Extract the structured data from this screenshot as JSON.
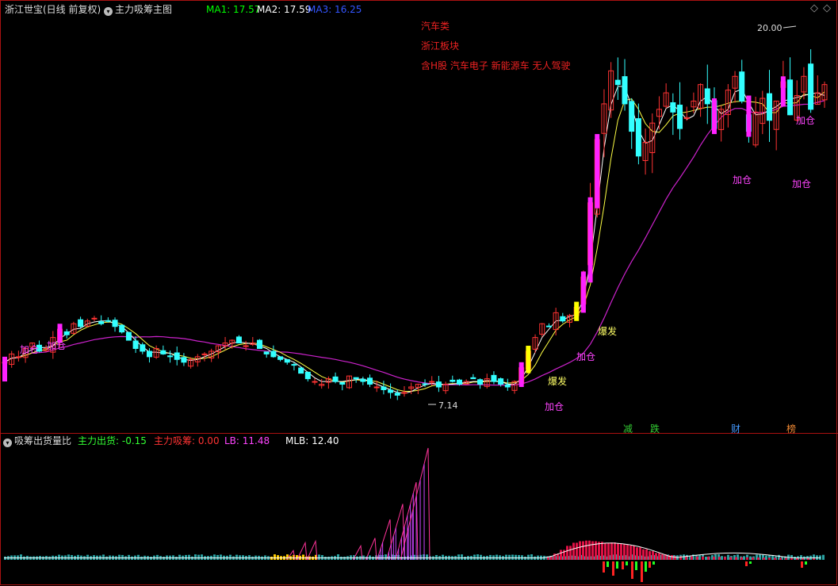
{
  "main_panel": {
    "title": "浙江世宝(日线 前复权)",
    "indicator_name": "主力吸筹主图",
    "menu_icon": "circle-chevron-down-icon",
    "ma_readouts": [
      {
        "label": "MA1: 17.57",
        "color": "#00ff00"
      },
      {
        "label": "MA2: 17.59",
        "color": "#ffffff"
      },
      {
        "label": "MA3: 16.25",
        "color": "#3355ff"
      }
    ],
    "info_lines": [
      "汽车类",
      "浙江板块",
      "含H股 汽车电子 新能源车 无人驾驶"
    ],
    "high_label": "20.00",
    "low_label": "7.14",
    "diamond_icon": "diamond-icon",
    "markers": [
      {
        "text": "加仓",
        "color": "#ff44ff"
      },
      {
        "text": "加仓",
        "color": "#ff44ff"
      },
      {
        "text": "加仓",
        "color": "#ff44ff"
      },
      {
        "text": "爆发",
        "color": "#ffff66"
      },
      {
        "text": "加仓",
        "color": "#ff44ff"
      },
      {
        "text": "爆发",
        "color": "#ffff66"
      },
      {
        "text": "加仓",
        "color": "#ff44ff"
      },
      {
        "text": "加仓",
        "color": "#ff44ff"
      },
      {
        "text": "加仓",
        "color": "#ff44ff"
      }
    ],
    "event_tags": [
      {
        "text": "减",
        "color": "#33cc33"
      },
      {
        "text": "跌",
        "color": "#33cc33"
      },
      {
        "text": "财",
        "color": "#4499ff"
      },
      {
        "text": "榜",
        "color": "#ee8833"
      }
    ]
  },
  "sub_panel": {
    "indicator_name": "吸筹出货量比",
    "readouts": [
      {
        "label": "主力出货: -0.15",
        "color": "#33ff33"
      },
      {
        "label": "主力吸筹: 0.00",
        "color": "#ff3333"
      },
      {
        "label": "LB: 11.48",
        "color": "#ff44ff"
      },
      {
        "label": "MLB: 12.40",
        "color": "#ffffff"
      }
    ]
  },
  "chart_data": [
    {
      "type": "candlestick",
      "title": "浙江世宝(日线 前复权)",
      "ylim": [
        6.0,
        21.0
      ],
      "annotated_high": 20.0,
      "annotated_low": 7.14,
      "close": [
        8.4,
        8.7,
        8.6,
        8.9,
        9.1,
        8.8,
        8.9,
        9.3,
        9.6,
        9.4,
        9.8,
        9.7,
        9.9,
        10.0,
        9.8,
        9.9,
        9.7,
        9.5,
        9.2,
        8.9,
        8.8,
        8.6,
        8.9,
        8.7,
        8.6,
        8.5,
        8.4,
        8.5,
        8.6,
        8.7,
        8.8,
        9.0,
        9.1,
        9.2,
        9.1,
        9.0,
        9.1,
        8.9,
        8.7,
        8.6,
        8.5,
        8.4,
        8.3,
        8.0,
        7.8,
        7.7,
        7.6,
        7.8,
        7.7,
        7.6,
        7.9,
        7.8,
        7.7,
        7.6,
        7.5,
        7.4,
        7.3,
        7.2,
        7.3,
        7.5,
        7.6,
        7.6,
        7.7,
        7.5,
        7.6,
        7.7,
        7.6,
        7.7,
        7.8,
        7.6,
        7.8,
        7.7,
        7.6,
        7.5,
        7.7,
        8.2,
        8.8,
        9.3,
        9.8,
        9.7,
        10.2,
        9.9,
        10.1,
        10.4,
        11.5,
        14.2,
        16.5,
        17.8,
        19.0,
        18.5,
        17.8,
        16.8,
        15.9,
        16.4,
        17.1,
        17.6,
        18.2,
        17.5,
        16.9,
        17.3,
        17.9,
        18.5,
        17.8,
        16.9,
        17.6,
        18.3,
        18.8,
        17.9,
        16.8,
        17.5,
        18.0,
        17.2,
        17.9,
        18.6,
        17.4,
        18.1,
        18.8,
        17.6,
        18.2,
        18.5
      ],
      "ma_labels": [
        "MA1: 17.57",
        "MA2: 17.59",
        "MA3: 16.25"
      ]
    },
    {
      "type": "bar",
      "title": "吸筹出货量比",
      "series": [
        {
          "name": "主力出货",
          "value": -0.15
        },
        {
          "name": "主力吸筹",
          "value": 0.0
        },
        {
          "name": "LB",
          "value": 11.48
        },
        {
          "name": "MLB",
          "value": 12.4
        }
      ],
      "spikes": [
        3.0,
        5.5,
        6.0,
        4.5,
        7.0,
        13.0,
        18.0,
        25.0,
        36.0
      ],
      "hump": [
        1.0,
        2.0,
        3.2,
        4.5,
        5.5,
        6.0,
        6.2,
        6.0,
        5.8,
        5.5,
        5.6,
        5.3,
        5.0,
        4.6,
        4.0,
        3.4,
        2.8,
        2.2,
        1.8,
        1.5
      ]
    }
  ]
}
